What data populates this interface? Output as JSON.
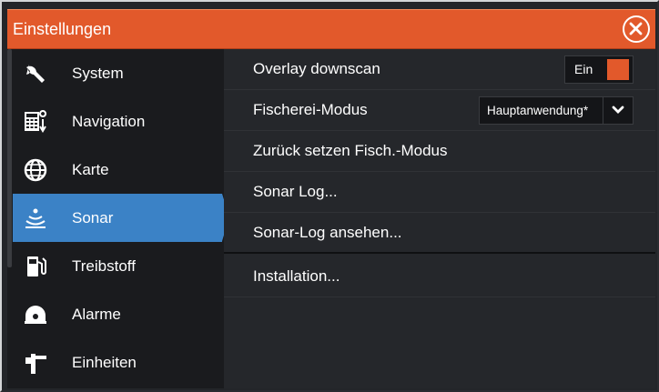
{
  "window": {
    "title": "Einstellungen",
    "close_icon": "close-circle-icon",
    "accent_color": "#e2592b",
    "selection_color": "#3b82c6"
  },
  "sidebar": {
    "items": [
      {
        "label": "System",
        "icon": "wrench-icon"
      },
      {
        "label": "Navigation",
        "icon": "navigation-icon"
      },
      {
        "label": "Karte",
        "icon": "globe-icon"
      },
      {
        "label": "Sonar",
        "icon": "sonar-icon",
        "selected": true
      },
      {
        "label": "Treibstoff",
        "icon": "fuel-icon"
      },
      {
        "label": "Alarme",
        "icon": "alarm-icon"
      },
      {
        "label": "Einheiten",
        "icon": "units-icon"
      }
    ]
  },
  "settings": {
    "rows": [
      {
        "label": "Overlay downscan",
        "control": "toggle",
        "toggle_label": "Ein",
        "state": "on"
      },
      {
        "label": "Fischerei-Modus",
        "control": "dropdown",
        "value": "Hauptanwendung*"
      },
      {
        "label": "Zurück setzen Fisch.-Modus"
      },
      {
        "label": "Sonar Log..."
      },
      {
        "label": "Sonar-Log ansehen..."
      },
      {
        "label": "Installation..."
      }
    ]
  }
}
